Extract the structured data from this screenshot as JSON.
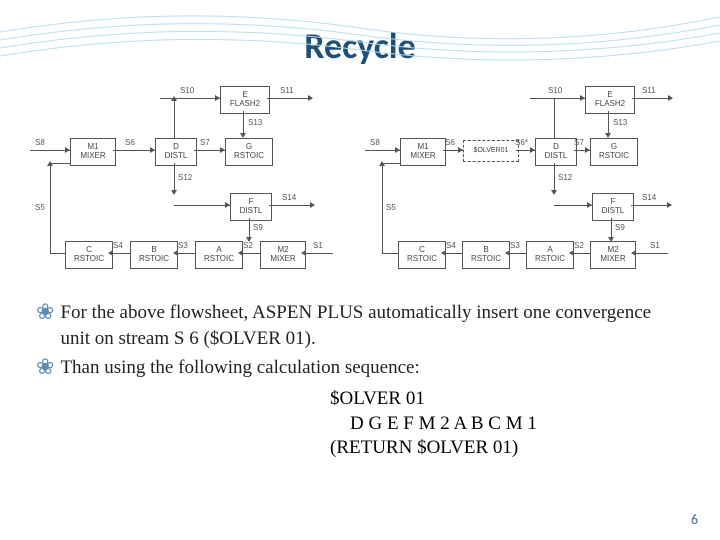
{
  "title": "Recycle",
  "left_diagram": {
    "streams": {
      "s10": "S10",
      "s11": "S11",
      "s13": "S13",
      "s8": "S8",
      "s6": "S6",
      "s7": "S7",
      "s12": "S12",
      "s14": "S14",
      "s5": "S5",
      "s4": "S4",
      "s3": "S3",
      "s2": "S2",
      "s1": "S1",
      "s9": "S9"
    },
    "blocks": {
      "e": "E\nFLASH2",
      "m1": "M1\nMIXER",
      "d": "D\nDISTL",
      "g": "G\nRSTOIC",
      "f": "F\nDISTL",
      "c": "C\nRSTOIC",
      "b": "B\nRSTOIC",
      "a": "A\nRSTOIC",
      "m2": "M2\nMIXER"
    }
  },
  "right_diagram": {
    "streams": {
      "s10": "S10",
      "s11": "S11",
      "s13": "S13",
      "s8": "S8",
      "s6": "S6",
      "s6star": "S6*",
      "s7": "S7",
      "s12": "S12",
      "s14": "S14",
      "s5": "S5",
      "s4": "S4",
      "s3": "S3",
      "s2": "S2",
      "s1": "S1",
      "s9": "S9"
    },
    "blocks": {
      "e": "E\nFLASH2",
      "m1": "M1\nMIXER",
      "olver": "$OLVER01",
      "d": "D\nDISTL",
      "g": "G\nRSTOIC",
      "f": "F\nDISTL",
      "c": "C\nRSTOIC",
      "b": "B\nRSTOIC",
      "a": "A\nRSTOIC",
      "m2": "M2\nMIXER"
    }
  },
  "bullets": [
    "For the above flowsheet, ASPEN PLUS automatically insert one convergence unit on stream S 6 ($OLVER 01).",
    "Than using the following calculation sequence:"
  ],
  "calc_sequence": {
    "line1": "$OLVER 01",
    "line2": "D G E F M 2 A B C M 1",
    "line3": "(RETURN $OLVER 01)"
  },
  "page_number": "6"
}
